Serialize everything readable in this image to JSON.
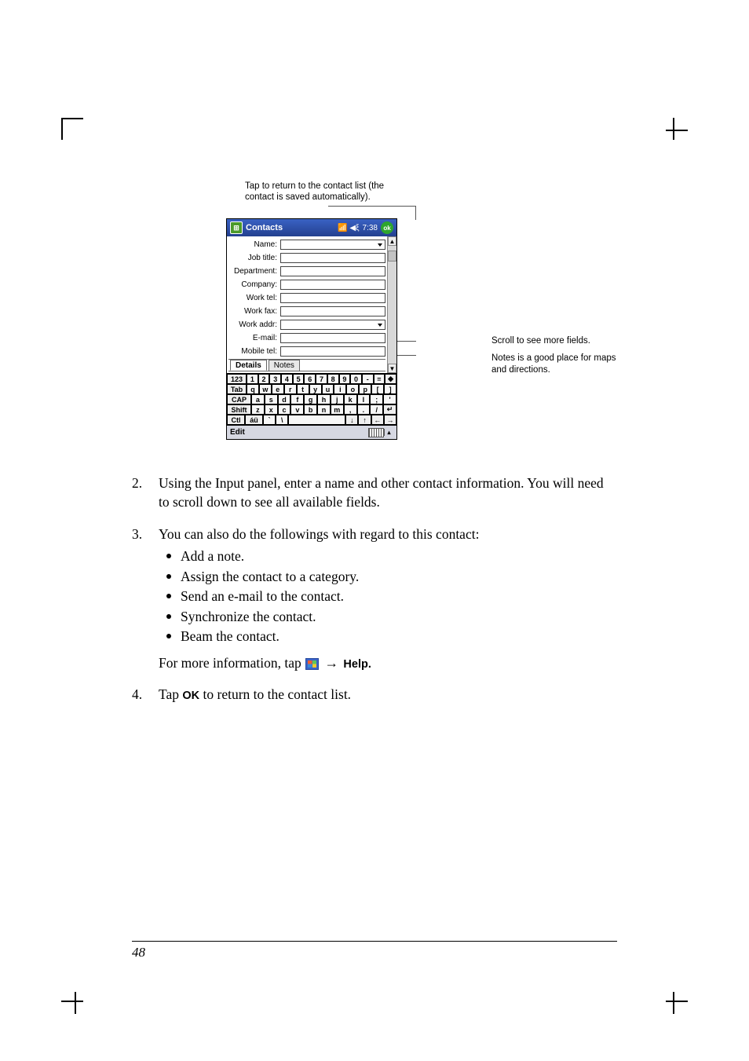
{
  "figure": {
    "top_caption_l1": "Tap to return to the contact list (the",
    "top_caption_l2": "contact is saved automatically).",
    "annot_right_1": "Scroll to see more fields.",
    "annot_right_2": "Notes is a good place for maps and directions."
  },
  "pda": {
    "app_title": "Contacts",
    "time": "7:38",
    "ok": "ok",
    "fields": {
      "name": "Name:",
      "job_title": "Job title:",
      "department": "Department:",
      "company": "Company:",
      "work_tel": "Work tel:",
      "work_fax": "Work fax:",
      "work_addr": "Work addr:",
      "email": "E-mail:",
      "mobile_tel": "Mobile tel:"
    },
    "tabs": {
      "details": "Details",
      "notes": "Notes"
    },
    "keyboard": {
      "row1": [
        "123",
        "1",
        "2",
        "3",
        "4",
        "5",
        "6",
        "7",
        "8",
        "9",
        "0",
        "-",
        "=",
        "◆"
      ],
      "row2": [
        "Tab",
        "q",
        "w",
        "e",
        "r",
        "t",
        "y",
        "u",
        "i",
        "o",
        "p",
        "[",
        "]"
      ],
      "row3": [
        "CAP",
        "a",
        "s",
        "d",
        "f",
        "g",
        "h",
        "j",
        "k",
        "l",
        ";",
        "'"
      ],
      "row4": [
        "Shift",
        "z",
        "x",
        "c",
        "v",
        "b",
        "n",
        "m",
        ",",
        ".",
        "/",
        "↵"
      ],
      "row5": [
        "Ctl",
        "áü",
        "`",
        "\\",
        " ",
        "↓",
        "↑",
        "←",
        "→"
      ]
    },
    "footer": {
      "edit": "Edit"
    }
  },
  "body": {
    "item2_num": "2.",
    "item2_text": "Using the Input panel, enter a name and other contact information. You will need to scroll down to see all available fields.",
    "item3_num": "3.",
    "item3_text": "You can also do the followings with regard to this contact:",
    "bullets": [
      "Add a note.",
      "Assign the contact to a category.",
      "Send an e-mail to the contact.",
      "Synchronize the contact.",
      "Beam the contact."
    ],
    "more_info_pre": "For more information, tap ",
    "more_info_help": "Help.",
    "item4_num": "4.",
    "item4_pre": "Tap ",
    "item4_ok": "OK",
    "item4_post": " to return to the contact list."
  },
  "page_number": "48"
}
